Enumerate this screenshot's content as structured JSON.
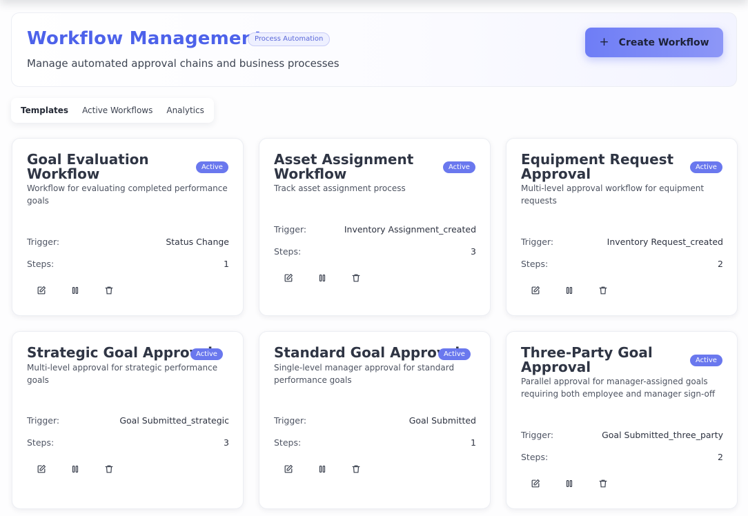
{
  "header": {
    "title": "Workflow Management",
    "badge": "Process Automation",
    "subtitle": "Manage automated approval chains and business processes",
    "create_button": {
      "icon": "plus-icon",
      "label": "Create Workflow"
    }
  },
  "tabs": [
    {
      "label": "Templates",
      "active": true
    },
    {
      "label": "Active Workflows",
      "active": false
    },
    {
      "label": "Analytics",
      "active": false
    }
  ],
  "field_labels": {
    "trigger": "Trigger:",
    "steps": "Steps:"
  },
  "action_icons": [
    "edit-icon",
    "pause-icon",
    "trash-icon"
  ],
  "colors": {
    "accent": "#4d62ea",
    "badge": "#6a78ee"
  },
  "cards": [
    {
      "title": "Goal Evaluation Workflow",
      "status": "Active",
      "description": "Workflow for evaluating completed performance goals",
      "trigger": "Status Change",
      "steps": "1"
    },
    {
      "title": "Asset Assignment Workflow",
      "status": "Active",
      "description": "Track asset assignment process",
      "trigger": "Inventory Assignment_created",
      "steps": "3"
    },
    {
      "title": "Equipment Request Approval",
      "status": "Active",
      "description": "Multi-level approval workflow for equipment requests",
      "trigger": "Inventory Request_created",
      "steps": "2"
    },
    {
      "title": "Strategic Goal Approval",
      "status": "Active",
      "description": "Multi-level approval for strategic performance goals",
      "trigger": "Goal Submitted_strategic",
      "steps": "3"
    },
    {
      "title": "Standard Goal Approval",
      "status": "Active",
      "description": "Single-level manager approval for standard performance goals",
      "trigger": "Goal Submitted",
      "steps": "1"
    },
    {
      "title": "Three-Party Goal Approval",
      "status": "Active",
      "description": "Parallel approval for manager-assigned goals requiring both employee and manager sign-off",
      "trigger": "Goal Submitted_three_party",
      "steps": "2"
    }
  ]
}
